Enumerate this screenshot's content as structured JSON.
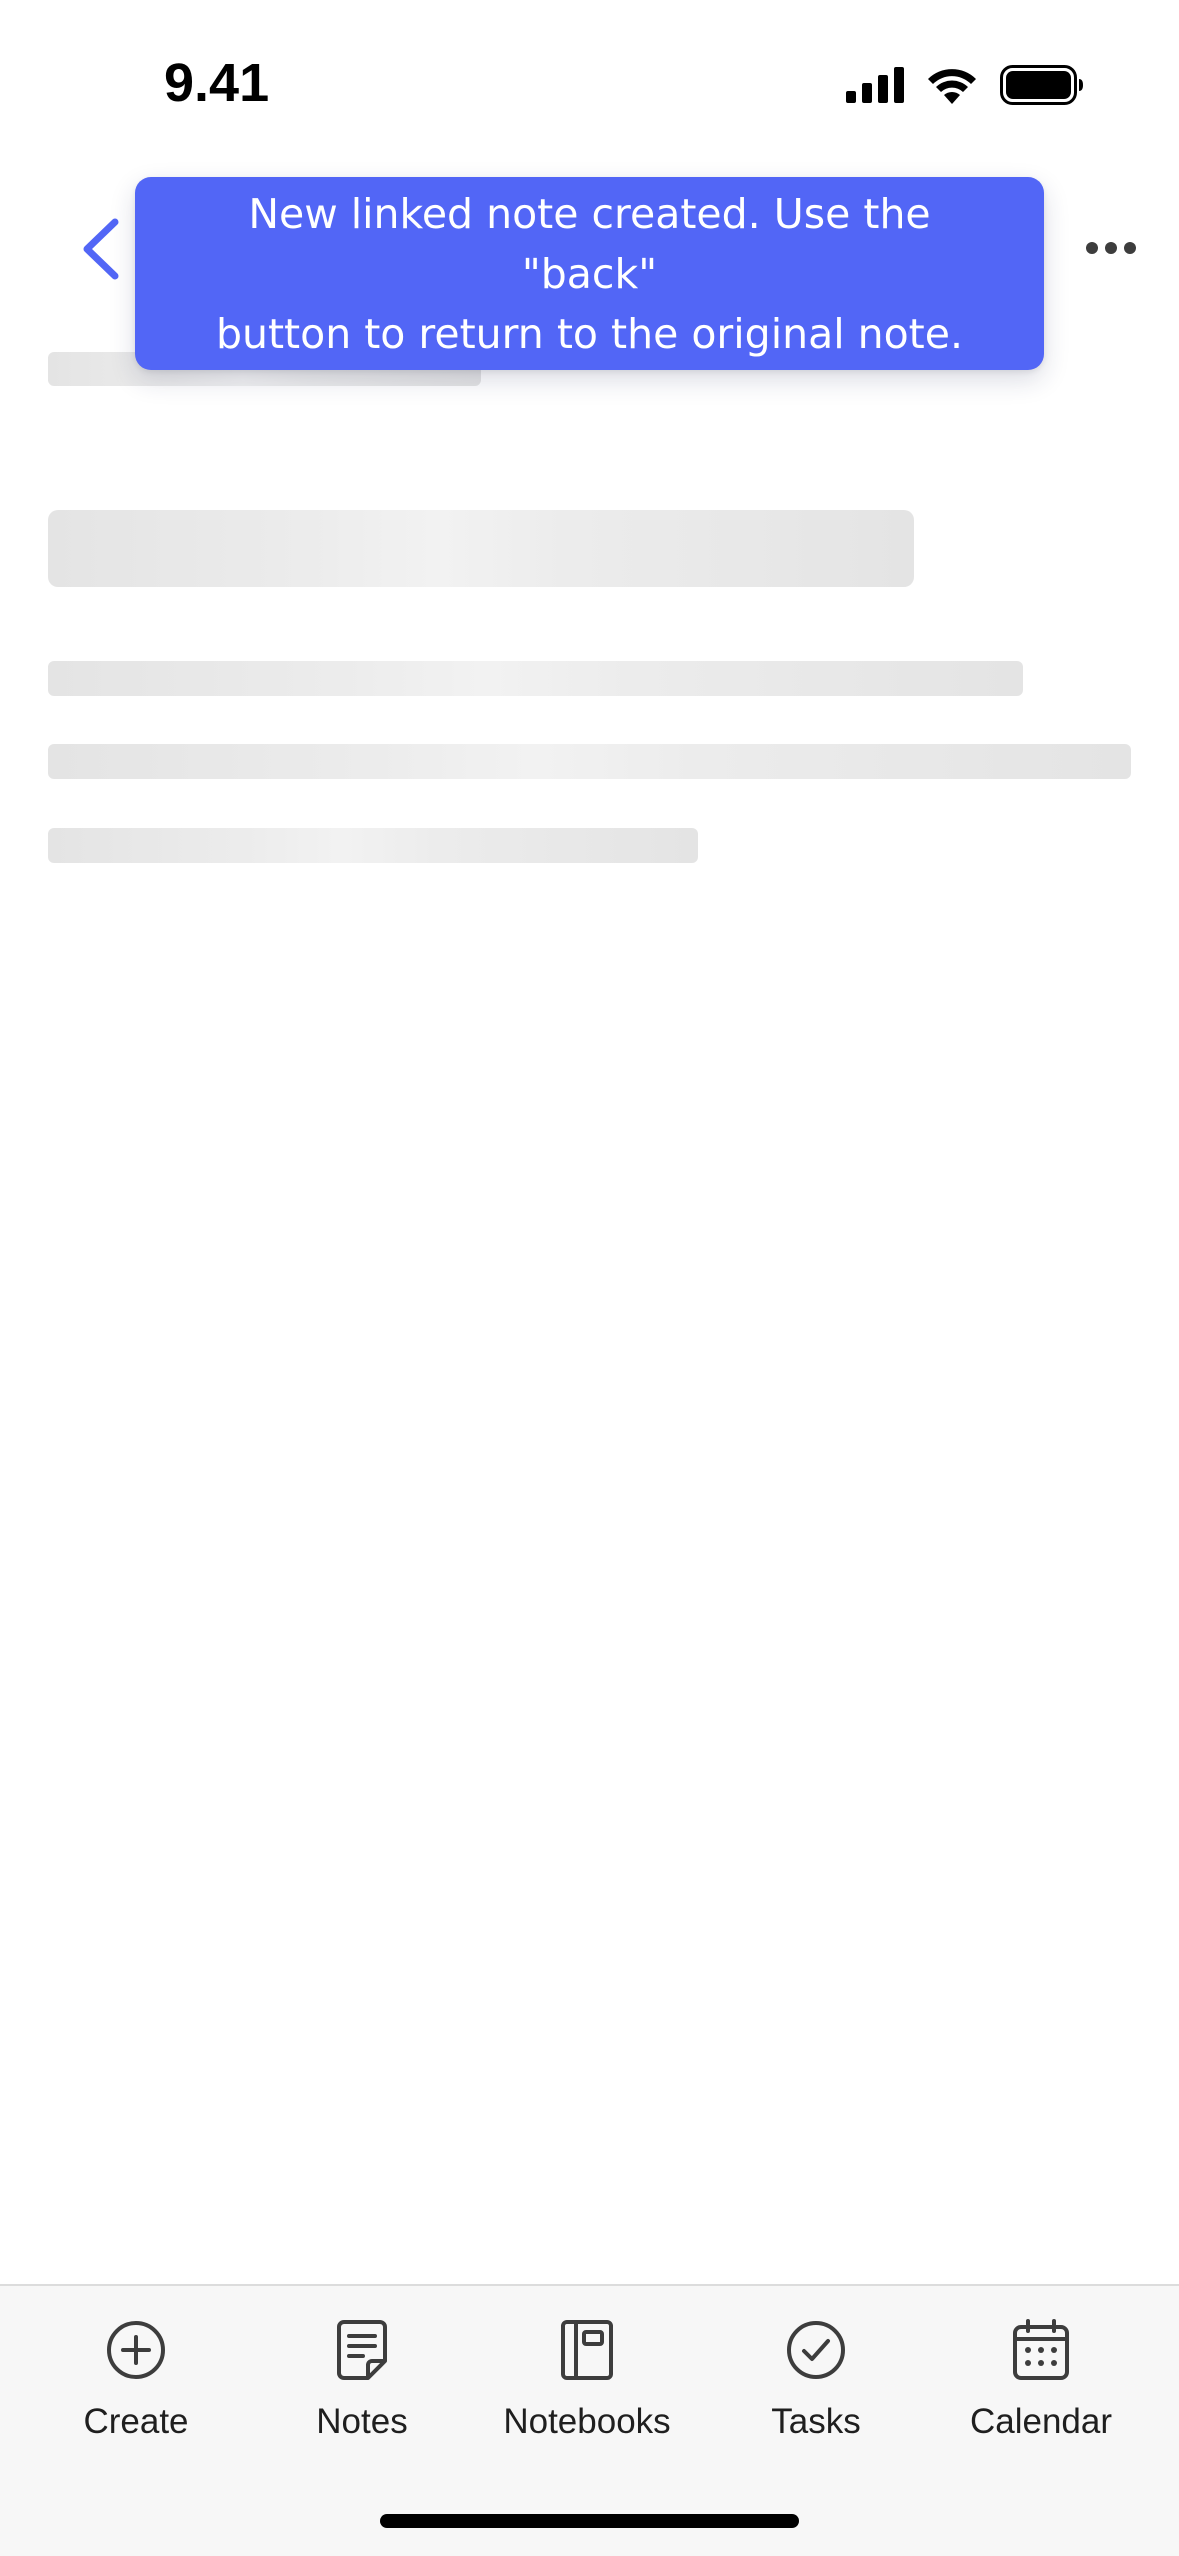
{
  "status_bar": {
    "time": "9.41",
    "icons": [
      "cellular-signal-icon",
      "wifi-icon",
      "battery-icon"
    ]
  },
  "header": {
    "back_icon": "chevron-left-icon",
    "more_icon": "more-horizontal-icon"
  },
  "toast": {
    "message": "New linked note created. Use the \"back\"\nbutton to return to the original note."
  },
  "tab_bar": {
    "tabs": [
      {
        "label": "Create",
        "icon": "plus-circle-icon"
      },
      {
        "label": "Notes",
        "icon": "note-icon"
      },
      {
        "label": "Notebooks",
        "icon": "notebook-icon"
      },
      {
        "label": "Tasks",
        "icon": "check-circle-icon"
      },
      {
        "label": "Calendar",
        "icon": "calendar-icon"
      }
    ]
  },
  "colors": {
    "accent": "#5266f6",
    "toast_text": "#ffffff",
    "skeleton": "#e4e4e4",
    "tab_bar_bg": "#f7f7f7",
    "icon": "#3d3d3d"
  }
}
